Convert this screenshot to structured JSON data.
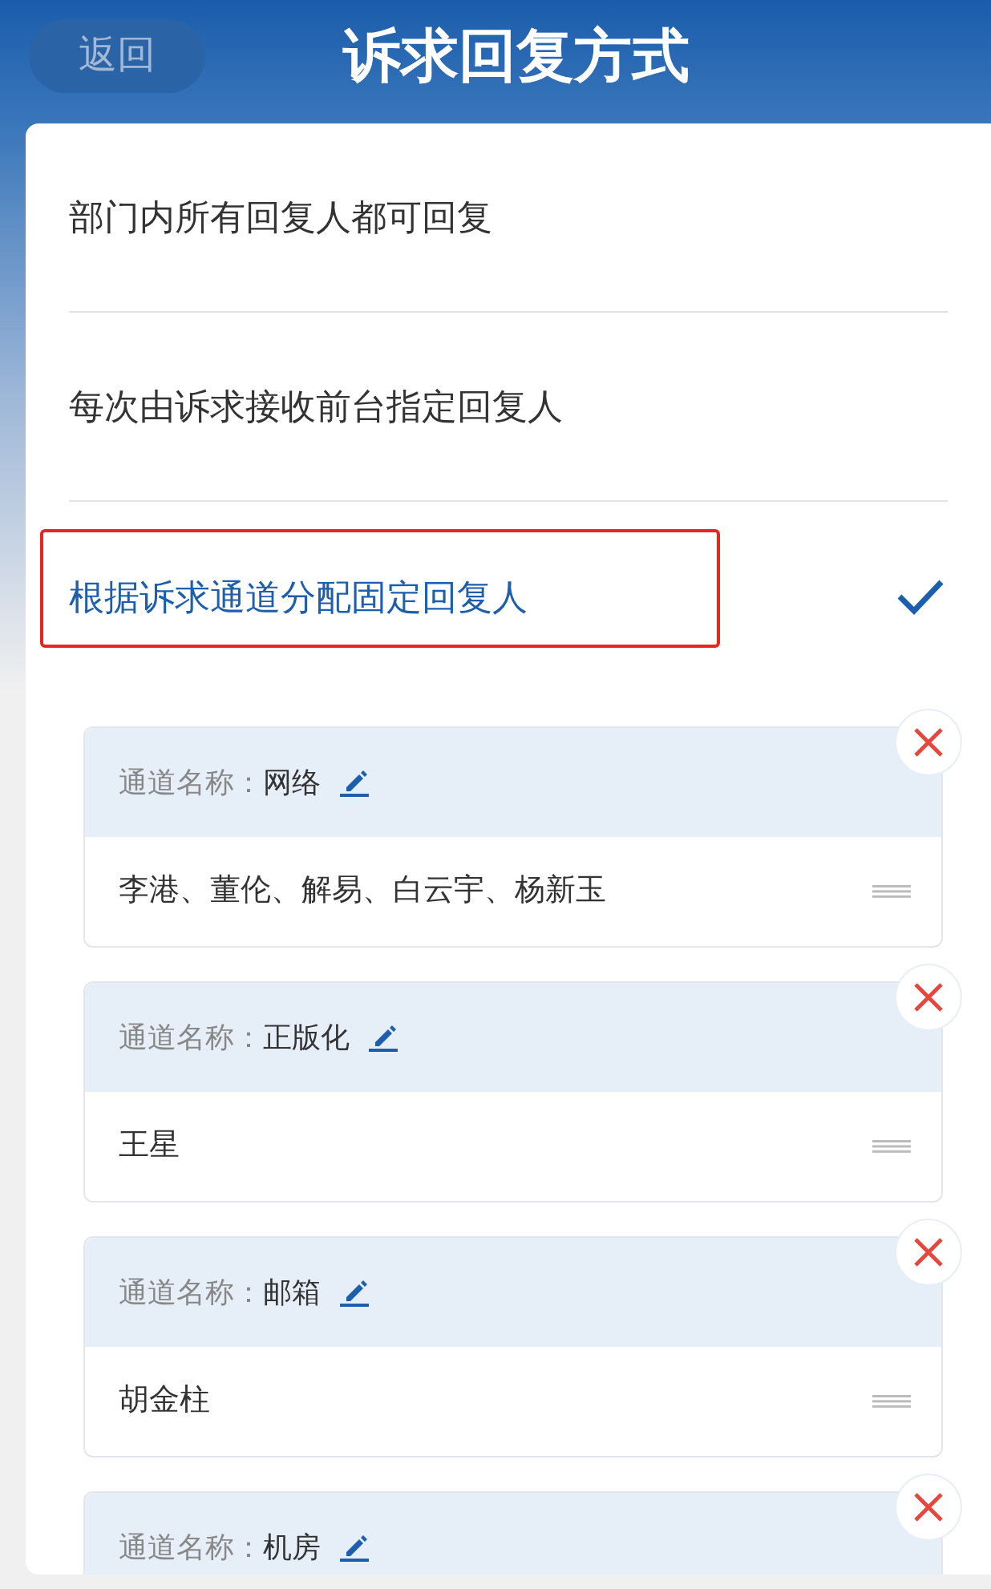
{
  "header": {
    "back_button": "返回",
    "title": "诉求回复方式"
  },
  "options": [
    {
      "label": "部门内所有回复人都可回复",
      "selected": false,
      "highlighted": false
    },
    {
      "label": "每次由诉求接收前台指定回复人",
      "selected": false,
      "highlighted": false
    },
    {
      "label": "根据诉求通道分配固定回复人",
      "selected": true,
      "highlighted": true
    }
  ],
  "channels": [
    {
      "field_label": "通道名称：",
      "name": "网络",
      "members": "李港、董伦、解易、白云宇、杨新玉"
    },
    {
      "field_label": "通道名称：",
      "name": "正版化",
      "members": "王星"
    },
    {
      "field_label": "通道名称：",
      "name": "邮箱",
      "members": "胡金柱"
    },
    {
      "field_label": "通道名称：",
      "name": "机房"
    }
  ]
}
